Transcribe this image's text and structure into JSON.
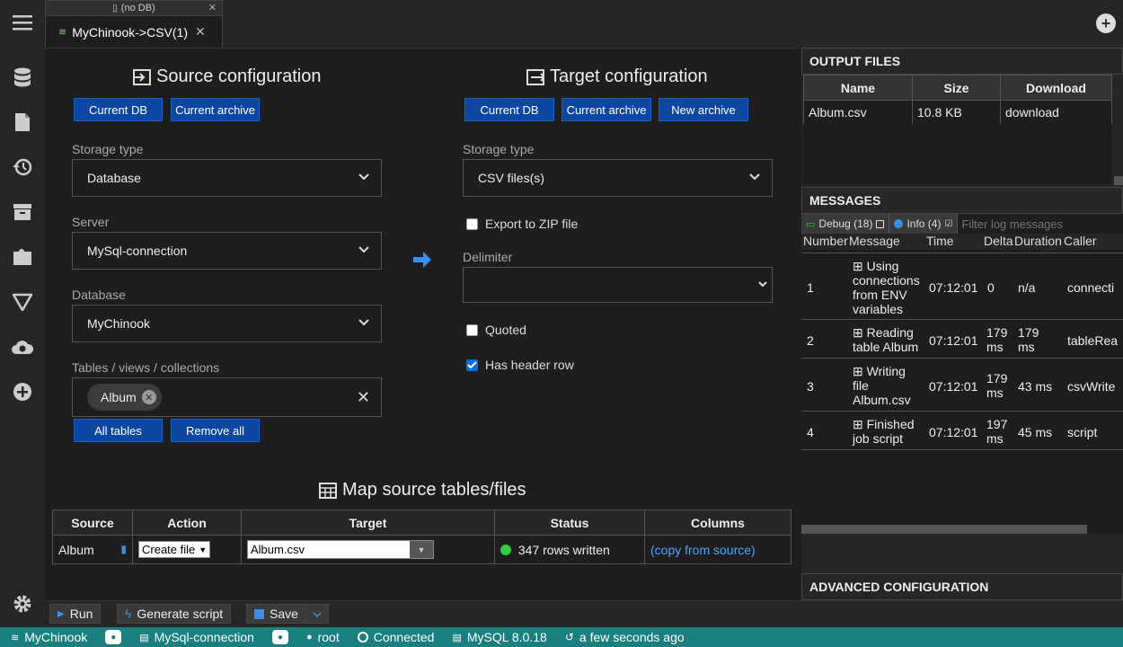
{
  "tabs": {
    "nodb": "(no DB)",
    "active": "MyChinook->CSV(1)",
    "close": "✕"
  },
  "source": {
    "title": "Source configuration",
    "btn_current_db": "Current DB",
    "btn_current_archive": "Current archive",
    "storage_label": "Storage type",
    "storage_value": "Database",
    "server_label": "Server",
    "server_value": "MySql-connection",
    "database_label": "Database",
    "database_value": "MyChinook",
    "tables_label": "Tables / views / collections",
    "table_chip": "Album",
    "btn_all_tables": "All tables",
    "btn_remove_all": "Remove all"
  },
  "target": {
    "title": "Target configuration",
    "btn_current_db": "Current DB",
    "btn_current_archive": "Current archive",
    "btn_new_archive": "New archive",
    "storage_label": "Storage type",
    "storage_value": "CSV files(s)",
    "export_zip": "Export to ZIP file",
    "export_zip_checked": false,
    "delimiter_label": "Delimiter",
    "delimiter_value": "",
    "quoted": "Quoted",
    "quoted_checked": false,
    "header_row": "Has header row",
    "header_row_checked": true
  },
  "map": {
    "title": "Map source tables/files",
    "headers": [
      "Source",
      "Action",
      "Target",
      "Status",
      "Columns"
    ],
    "row": {
      "source": "Album",
      "action": "Create file",
      "target": "Album.csv",
      "status": "347 rows written",
      "columns": "(copy from source)"
    }
  },
  "output_files": {
    "title": "OUTPUT FILES",
    "headers": [
      "Name",
      "Size",
      "Download"
    ],
    "row": {
      "name": "Album.csv",
      "size": "10.8 KB",
      "download": "download"
    }
  },
  "messages": {
    "title": "MESSAGES",
    "debug": "Debug (18)",
    "info": "Info (4)",
    "filter_placeholder": "Filter log messages",
    "headers": [
      "Number",
      "Message",
      "Time",
      "Delta",
      "Duration",
      "Caller"
    ],
    "rows": [
      {
        "number": "1",
        "message": "Using connections from ENV variables",
        "time": "07:12:01",
        "delta": "0",
        "duration": "n/a",
        "caller": "connecti"
      },
      {
        "number": "2",
        "message": "Reading table Album",
        "time": "07:12:01",
        "delta": "179 ms",
        "duration": "179 ms",
        "caller": "tableRea"
      },
      {
        "number": "3",
        "message": "Writing file Album.csv",
        "time": "07:12:01",
        "delta": "179 ms",
        "duration": "43 ms",
        "caller": "csvWrite"
      },
      {
        "number": "4",
        "message": "Finished job script",
        "time": "07:12:01",
        "delta": "197 ms",
        "duration": "45 ms",
        "caller": "script"
      }
    ]
  },
  "advanced": "ADVANCED CONFIGURATION",
  "toolbar": {
    "run": "Run",
    "generate": "Generate script",
    "save": "Save"
  },
  "status": {
    "db": "MyChinook",
    "connection": "MySql-connection",
    "user": "root",
    "connected": "Connected",
    "version": "MySQL 8.0.18",
    "time": "a few seconds ago"
  },
  "colors": {
    "accent": "#0d47a1",
    "status_bar": "#1a7f7f",
    "link": "#4fa3ff",
    "success": "#2ecc40"
  }
}
